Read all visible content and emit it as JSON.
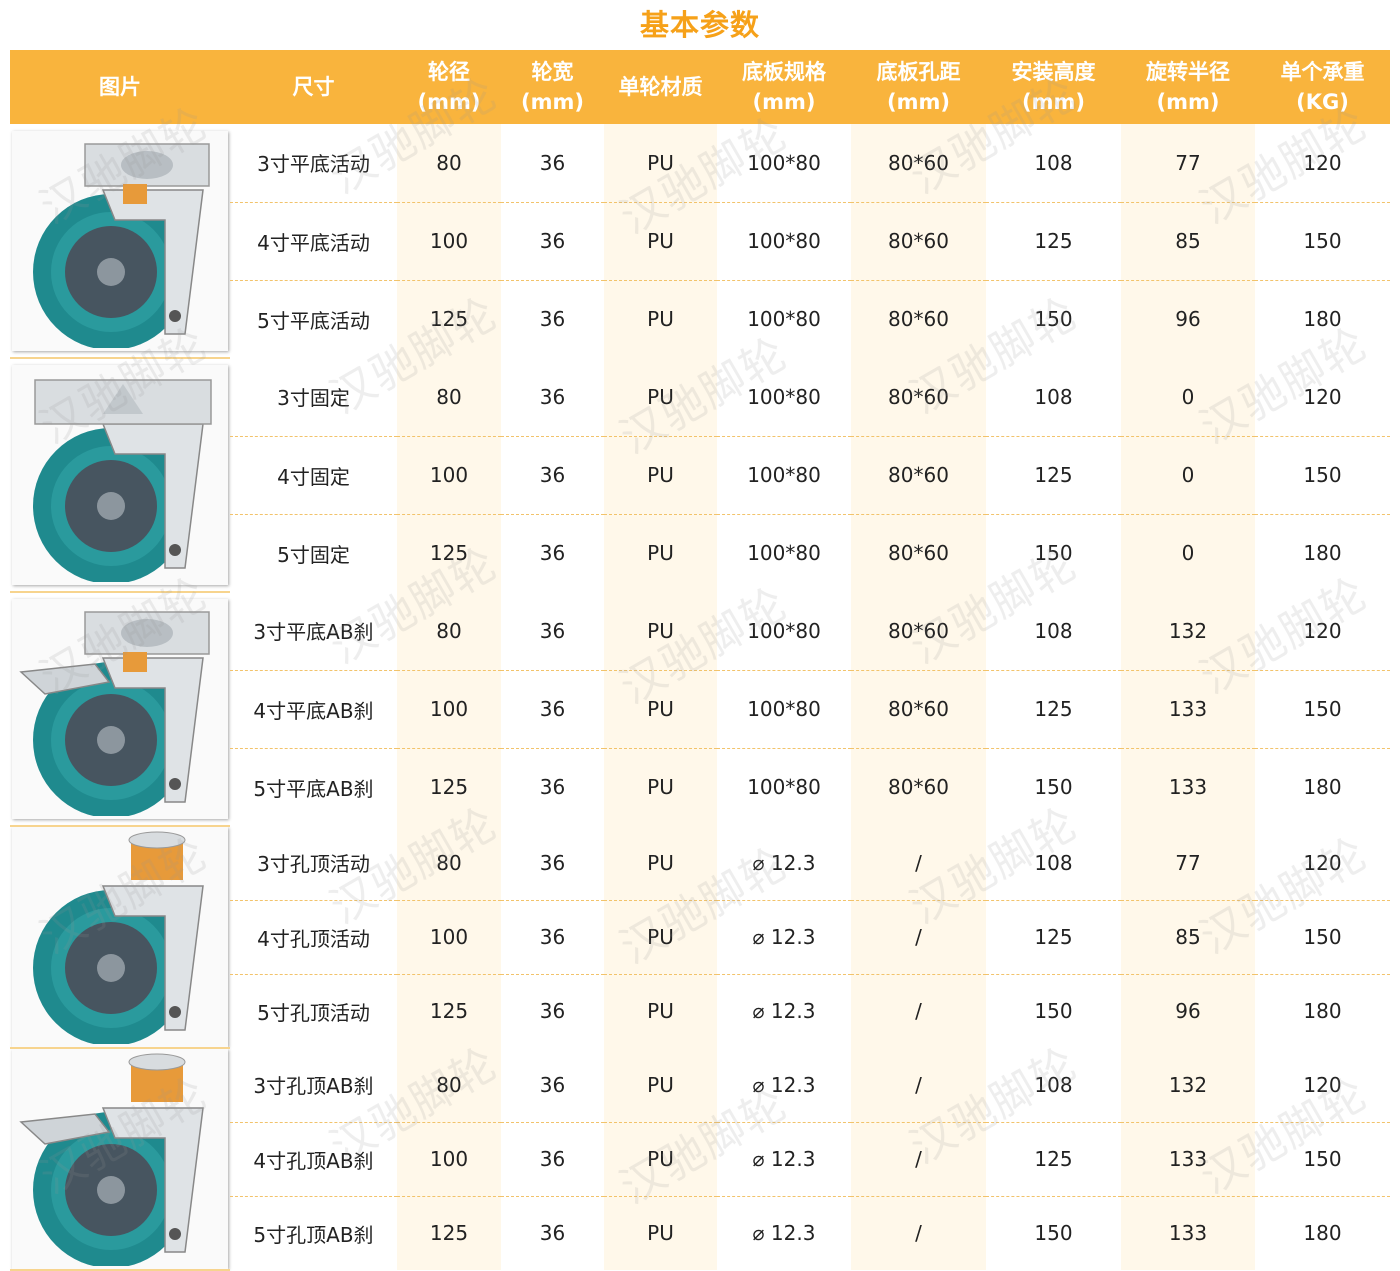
{
  "title": "基本参数",
  "watermark_text": "汉驰脚轮",
  "colors": {
    "header_bg": "#f9b43d",
    "title": "#f6a119",
    "wheel": "#1f8a8e",
    "hub": "#475560"
  },
  "headers": [
    "图片",
    "尺寸",
    "轮径\n(mm)",
    "轮宽\n(mm)",
    "单轮材质",
    "底板规格\n(mm)",
    "底板孔距\n(mm)",
    "安装高度\n(mm)",
    "旋转半径\n(mm)",
    "单个承重\n(KG)"
  ],
  "groups": [
    {
      "image": "swivel-plate-caster-image",
      "rows": [
        [
          "3寸平底活动",
          "80",
          "36",
          "PU",
          "100*80",
          "80*60",
          "108",
          "77",
          "120"
        ],
        [
          "4寸平底活动",
          "100",
          "36",
          "PU",
          "100*80",
          "80*60",
          "125",
          "85",
          "150"
        ],
        [
          "5寸平底活动",
          "125",
          "36",
          "PU",
          "100*80",
          "80*60",
          "150",
          "96",
          "180"
        ]
      ]
    },
    {
      "image": "fixed-caster-image",
      "rows": [
        [
          "3寸固定",
          "80",
          "36",
          "PU",
          "100*80",
          "80*60",
          "108",
          "0",
          "120"
        ],
        [
          "4寸固定",
          "100",
          "36",
          "PU",
          "100*80",
          "80*60",
          "125",
          "0",
          "150"
        ],
        [
          "5寸固定",
          "125",
          "36",
          "PU",
          "100*80",
          "80*60",
          "150",
          "0",
          "180"
        ]
      ]
    },
    {
      "image": "plate-brake-caster-image",
      "rows": [
        [
          "3寸平底AB刹",
          "80",
          "36",
          "PU",
          "100*80",
          "80*60",
          "108",
          "132",
          "120"
        ],
        [
          "4寸平底AB刹",
          "100",
          "36",
          "PU",
          "100*80",
          "80*60",
          "125",
          "133",
          "150"
        ],
        [
          "5寸平底AB刹",
          "125",
          "36",
          "PU",
          "100*80",
          "80*60",
          "150",
          "133",
          "180"
        ]
      ]
    },
    {
      "image": "bolt-hole-swivel-caster-image",
      "rows": [
        [
          "3寸孔顶活动",
          "80",
          "36",
          "PU",
          "⌀ 12.3",
          "/",
          "108",
          "77",
          "120"
        ],
        [
          "4寸孔顶活动",
          "100",
          "36",
          "PU",
          "⌀ 12.3",
          "/",
          "125",
          "85",
          "150"
        ],
        [
          "5寸孔顶活动",
          "125",
          "36",
          "PU",
          "⌀ 12.3",
          "/",
          "150",
          "96",
          "180"
        ]
      ]
    },
    {
      "image": "bolt-hole-brake-caster-image",
      "rows": [
        [
          "3寸孔顶AB刹",
          "80",
          "36",
          "PU",
          "⌀ 12.3",
          "/",
          "108",
          "132",
          "120"
        ],
        [
          "4寸孔顶AB刹",
          "100",
          "36",
          "PU",
          "⌀ 12.3",
          "/",
          "125",
          "133",
          "150"
        ],
        [
          "5寸孔顶AB刹",
          "125",
          "36",
          "PU",
          "⌀ 12.3",
          "/",
          "150",
          "133",
          "180"
        ]
      ]
    }
  ]
}
